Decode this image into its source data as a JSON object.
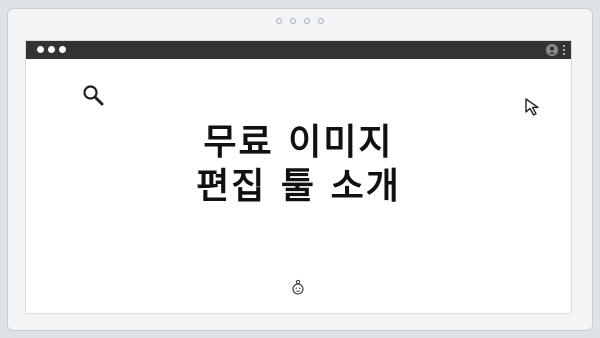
{
  "page": {
    "headline_line1": "무료 이미지",
    "headline_line2": "편집 툴 소개"
  },
  "icons": {
    "search": "search-icon",
    "cursor": "cursor-arrow-icon",
    "user": "user-icon",
    "menu": "kebab-menu-icon",
    "decor": "baby-face-icon"
  },
  "colors": {
    "titlebar": "#333333",
    "background": "#dfe3e8",
    "canvas": "#ffffff",
    "text": "#111111"
  }
}
